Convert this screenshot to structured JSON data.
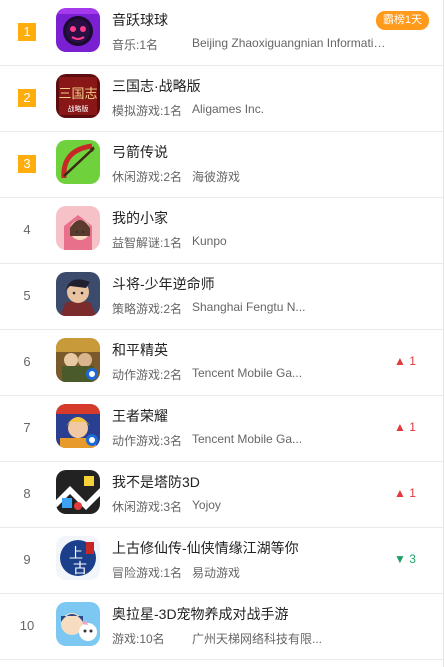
{
  "rows": [
    {
      "rank": "1",
      "title": "音跃球球",
      "category": "音乐:1名",
      "developer": "Beijing Zhaoxiguangnian Informatio...",
      "badge": "霸榜1天",
      "change_arrow": "",
      "change_value": "",
      "icon": "music-ball-icon"
    },
    {
      "rank": "2",
      "title": "三国志·战略版",
      "category": "模拟游戏:1名",
      "developer": "Aligames Inc.",
      "badge": "",
      "change_arrow": "",
      "change_value": "",
      "icon": "three-kingdoms-icon"
    },
    {
      "rank": "3",
      "title": "弓箭传说",
      "category": "休闲游戏:2名",
      "developer": "海彼游戏",
      "badge": "",
      "change_arrow": "",
      "change_value": "",
      "icon": "bow-arrow-icon"
    },
    {
      "rank": "4",
      "title": "我的小家",
      "category": "益智解谜:1名",
      "developer": "Kunpo",
      "badge": "",
      "change_arrow": "",
      "change_value": "",
      "icon": "my-home-icon"
    },
    {
      "rank": "5",
      "title": "斗将-少年逆命师",
      "category": "策略游戏:2名",
      "developer": "Shanghai Fengtu N...",
      "badge": "",
      "change_arrow": "",
      "change_value": "",
      "icon": "warrior-icon"
    },
    {
      "rank": "6",
      "title": "和平精英",
      "category": "动作游戏:2名",
      "developer": "Tencent Mobile Ga...",
      "badge": "",
      "change_arrow": "▲",
      "change_value": "1",
      "change_dir": "up",
      "icon": "peace-elite-icon"
    },
    {
      "rank": "7",
      "title": "王者荣耀",
      "category": "动作游戏:3名",
      "developer": "Tencent Mobile Ga...",
      "badge": "",
      "change_arrow": "▲",
      "change_value": "1",
      "change_dir": "up",
      "icon": "honor-of-kings-icon"
    },
    {
      "rank": "8",
      "title": "我不是塔防3D",
      "category": "休闲游戏:3名",
      "developer": "Yojoy",
      "badge": "",
      "change_arrow": "▲",
      "change_value": "1",
      "change_dir": "up",
      "icon": "tower-defense-icon"
    },
    {
      "rank": "9",
      "title": "上古修仙传-仙侠情缘江湖等你",
      "category": "冒险游戏:1名",
      "developer": "易动游戏",
      "badge": "",
      "change_arrow": "▼",
      "change_value": "3",
      "change_dir": "down",
      "icon": "xianxia-icon"
    },
    {
      "rank": "10",
      "title": "奥拉星-3D宠物养成对战手游",
      "category": "游戏:10名",
      "developer": "广州天梯网络科技有限...",
      "badge": "",
      "change_arrow": "",
      "change_value": "",
      "icon": "aola-star-icon"
    }
  ],
  "colors": {
    "rank_highlight": "#ffad0d",
    "badge": "#ff9a1a",
    "up": "#e0393e",
    "down": "#20a067"
  }
}
